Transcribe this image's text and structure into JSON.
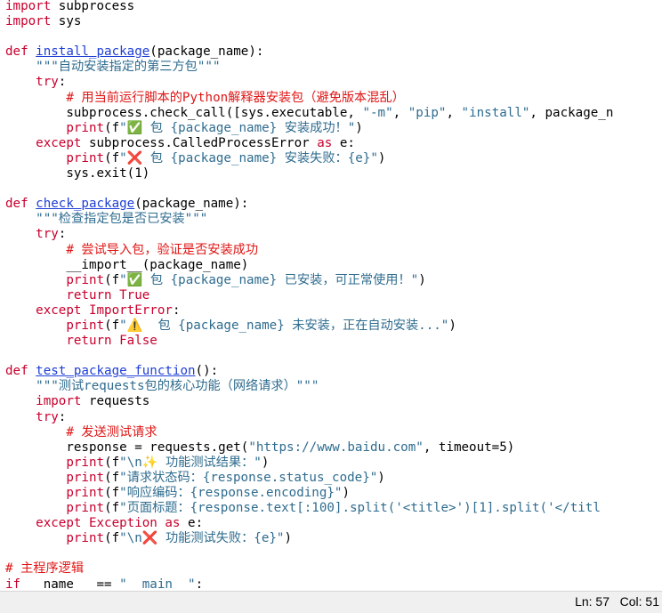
{
  "colors": {
    "keyword": "#c8002d",
    "function_name": "#1f3fd6",
    "string": "#2f6c8f",
    "comment": "#e01616",
    "builtin": "#2e3ad8",
    "statusbar_bg": "#f0f0f0"
  },
  "icons": {
    "check": "check-mark-emoji",
    "cross": "cross-mark-emoji",
    "warning": "warning-emoji",
    "sparkle": "sparkle-emoji"
  },
  "code_lines": [
    "import subprocess",
    "import sys",
    "",
    "def install_package(package_name):",
    "    \"\"\"自动安装指定的第三方包\"\"\"",
    "    try:",
    "        # 用当前运行脚本的Python解释器安装包（避免版本混乱）",
    "        subprocess.check_call([sys.executable, \"-m\", \"pip\", \"install\", package_n",
    "        print(f\"✅ 包 {package_name} 安装成功！\")",
    "    except subprocess.CalledProcessError as e:",
    "        print(f\"❌ 包 {package_name} 安装失败：{e}\")",
    "        sys.exit(1)",
    "",
    "def check_package(package_name):",
    "    \"\"\"检查指定包是否已安装\"\"\"",
    "    try:",
    "        # 尝试导入包，验证是否安装成功",
    "        __import__(package_name)",
    "        print(f\"✅ 包 {package_name} 已安装，可正常使用！\")",
    "        return True",
    "    except ImportError:",
    "        print(f\"⚠️  包 {package_name} 未安装，正在自动安装...\")",
    "        return False",
    "",
    "def test_package_function():",
    "    \"\"\"测试requests包的核心功能（网络请求）\"\"\"",
    "    import requests",
    "    try:",
    "        # 发送测试请求",
    "        response = requests.get(\"https://www.baidu.com\", timeout=5)",
    "        print(f\"\\n✨ 功能测试结果：\")",
    "        print(f\"请求状态码：{response.status_code}\")",
    "        print(f\"响应编码：{response.encoding}\")",
    "        print(f\"页面标题：{response.text[:100].split('<title>')[1].split('</titl",
    "    except Exception as e:",
    "        print(f\"\\n❌ 功能测试失败：{e}\")",
    "",
    "# 主程序逻辑",
    "if __name__ == \"__main__\":"
  ],
  "status": {
    "line": "Ln: 57",
    "column": "Col: 51"
  }
}
